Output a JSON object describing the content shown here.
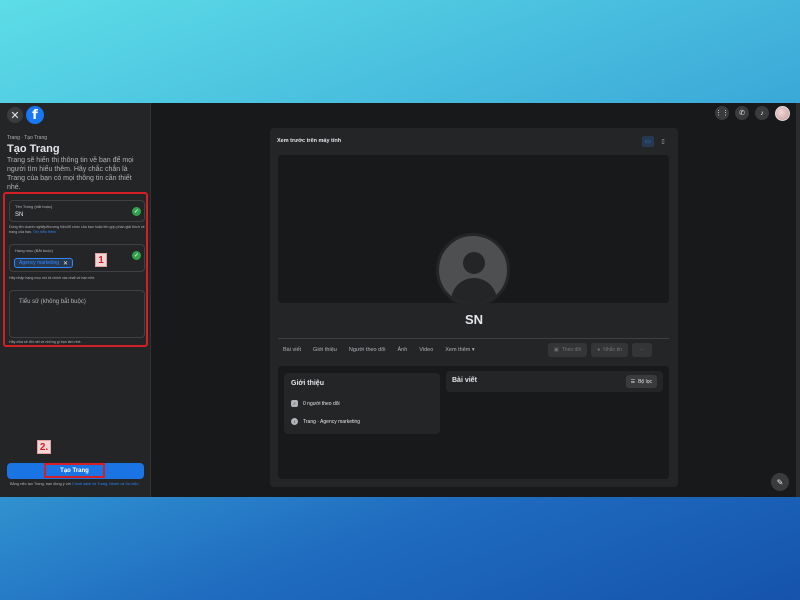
{
  "sidebar": {
    "close_icon": "✕",
    "logo_letter": "f",
    "breadcrumb": "Trang · Tạo Trang",
    "title": "Tạo Trang",
    "description": "Trang sẽ hiển thị thông tin về bạn để mọi người tìm hiểu thêm. Hãy chắc chắn là Trang của bạn có mọi thông tin cần thiết nhé.",
    "name_field": {
      "label": "Tên Trang (bắt buộc)",
      "value": "SN",
      "help_text": "Dùng tên doanh nghiệp/thương hiệu/tổ chức của bạn hoặc tên góp phần giải thích về trang của bạn.",
      "help_link": "Tìm hiểu thêm"
    },
    "category_field": {
      "label": "Hạng mục (Bắt buộc)",
      "chip": "Agency marketing",
      "help_text": "Hãy nhập hạng mục mô tả chính xác nhất về bạn nhé."
    },
    "bio_field": {
      "placeholder": "Tiểu sử (không bắt buộc)",
      "help_text": "Hãy chia sẻ đôi nét về những gì bạn làm nhé."
    },
    "step1": "1",
    "step2": "2.",
    "create_button": "Tạo Trang",
    "terms_text": "Bằng việc tạo Trang, bạn đồng ý với",
    "terms_link": "Chính sách về Trang, Nhóm và Sự kiện"
  },
  "topbar": {
    "icons": [
      "grid-menu-icon",
      "messenger-icon",
      "bell-icon",
      "avatar"
    ]
  },
  "preview": {
    "title": "Xem trước trên máy tính",
    "page_name": "SN",
    "tabs": [
      "Bài viết",
      "Giới thiệu",
      "Người theo dõi",
      "Ảnh",
      "Video",
      "Xem thêm ▾"
    ],
    "follow_button": "Theo dõi",
    "message_button": "Nhắn tin",
    "more_button": "···",
    "intro": {
      "title": "Giới thiệu",
      "followers": "0 người theo dõi",
      "category": "Trang · Agency marketing"
    },
    "posts": {
      "title": "Bài viết",
      "filter_button": "Bộ lọc"
    }
  }
}
